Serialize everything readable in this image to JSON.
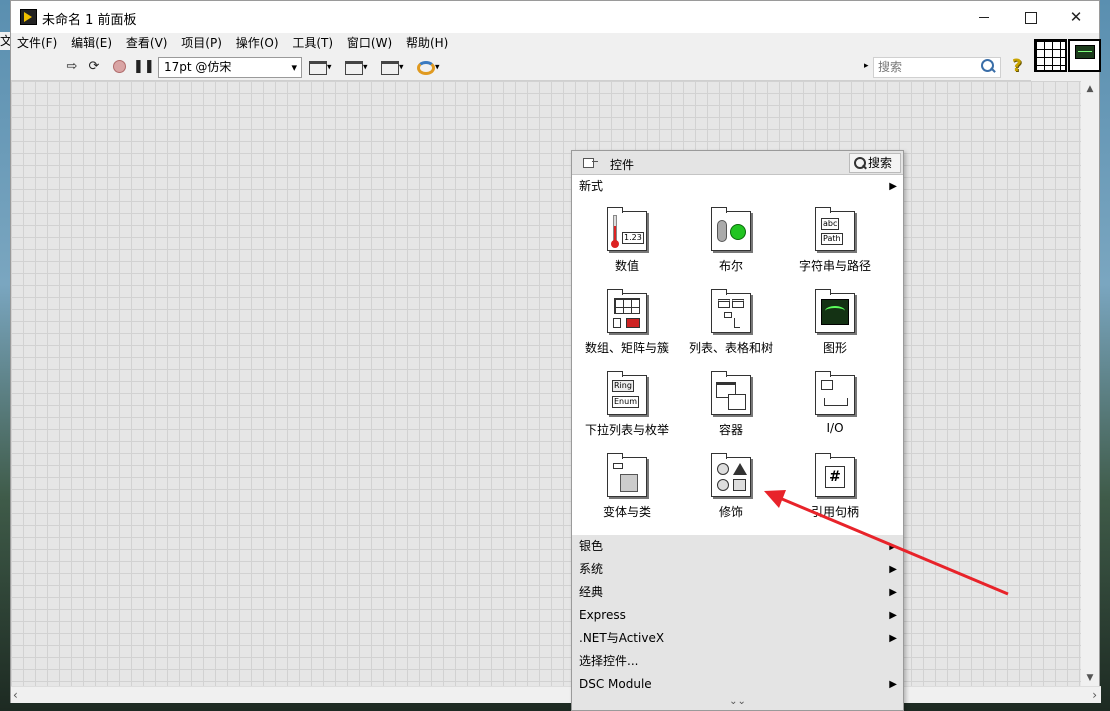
{
  "window": {
    "title": "未命名 1 前面板",
    "left_stub": "文"
  },
  "menu": [
    {
      "label": "文件(F)"
    },
    {
      "label": "编辑(E)"
    },
    {
      "label": "查看(V)"
    },
    {
      "label": "项目(P)"
    },
    {
      "label": "操作(O)"
    },
    {
      "label": "工具(T)"
    },
    {
      "label": "窗口(W)"
    },
    {
      "label": "帮助(H)"
    }
  ],
  "toolbar": {
    "font_value": "17pt @仿宋",
    "search_placeholder": "搜索",
    "help_glyph": "?"
  },
  "palette": {
    "title": "控件",
    "search_label": "搜索",
    "top_category": "新式",
    "items": [
      {
        "label": "数值",
        "icon": "numeric-icon"
      },
      {
        "label": "布尔",
        "icon": "boolean-icon"
      },
      {
        "label": "字符串与路径",
        "icon": "string-path-icon"
      },
      {
        "label": "数组、矩阵与簇",
        "icon": "array-matrix-cluster-icon"
      },
      {
        "label": "列表、表格和树",
        "icon": "list-table-tree-icon"
      },
      {
        "label": "图形",
        "icon": "graph-icon"
      },
      {
        "label": "下拉列表与枚举",
        "icon": "ring-enum-icon"
      },
      {
        "label": "容器",
        "icon": "containers-icon"
      },
      {
        "label": "I/O",
        "icon": "io-icon"
      },
      {
        "label": "变体与类",
        "icon": "variant-class-icon"
      },
      {
        "label": "修饰",
        "icon": "decorations-icon"
      },
      {
        "label": "引用句柄",
        "icon": "refnum-icon"
      }
    ],
    "icon_text": {
      "numeric": "1.23",
      "string_abc": "abc",
      "string_path": "Path",
      "ring": "Ring",
      "enum": "Enum",
      "refnum": "#"
    },
    "categories": [
      {
        "label": "银色"
      },
      {
        "label": "系统"
      },
      {
        "label": "经典"
      },
      {
        "label": "Express"
      },
      {
        "label": ".NET与ActiveX"
      },
      {
        "label": "选择控件..."
      },
      {
        "label": "DSC Module"
      }
    ]
  },
  "colors": {
    "annotation_arrow": "#e8232a",
    "boolean_led": "#21c421"
  }
}
